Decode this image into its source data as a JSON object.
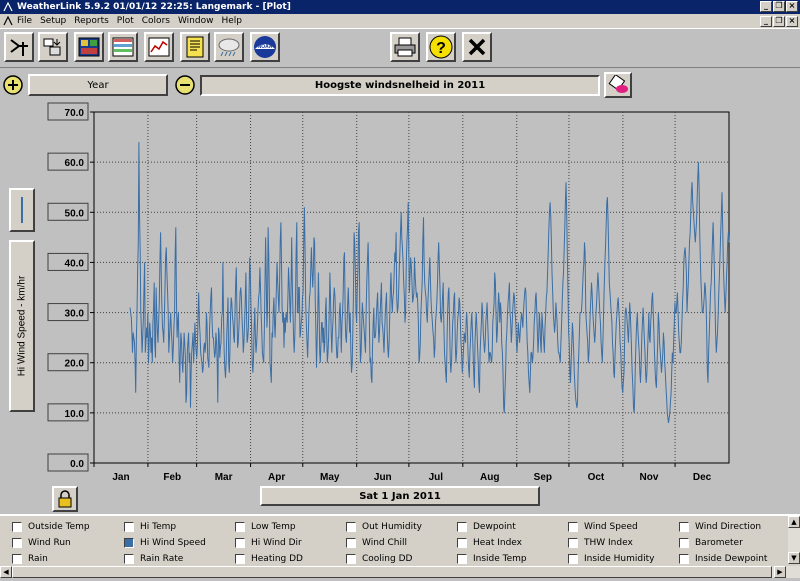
{
  "window": {
    "title": "WeatherLink 5.9.2  01/01/12  22:25: Langemark - [Plot]"
  },
  "menu": [
    "File",
    "Setup",
    "Reports",
    "Plot",
    "Colors",
    "Window",
    "Help"
  ],
  "toolbar": {
    "icons": [
      "station-select-icon",
      "download-icon",
      "bulletin-icon",
      "strip-chart-icon",
      "graph-icon",
      "noaa-summary-icon",
      "weather-upload-icon",
      "noaa-icon",
      "print-icon",
      "help-icon",
      "close-icon"
    ]
  },
  "controls": {
    "span_label": "Year",
    "plot_title": "Hoogste windsnelheid  in 2011",
    "date_label": "Sat 1 Jan 2011"
  },
  "legend": {
    "rows": [
      [
        {
          "label": "Outside Temp",
          "checked": false
        },
        {
          "label": "Hi Temp",
          "checked": false
        },
        {
          "label": "Low Temp",
          "checked": false
        },
        {
          "label": "Out Humidity",
          "checked": false
        },
        {
          "label": "Dewpoint",
          "checked": false
        },
        {
          "label": "Wind Speed",
          "checked": false
        },
        {
          "label": "Wind Direction",
          "checked": false
        }
      ],
      [
        {
          "label": "Wind Run",
          "checked": false
        },
        {
          "label": "Hi Wind Speed",
          "checked": true
        },
        {
          "label": "Hi Wind Dir",
          "checked": false
        },
        {
          "label": "Wind Chill",
          "checked": false
        },
        {
          "label": "Heat Index",
          "checked": false
        },
        {
          "label": "THW Index",
          "checked": false
        },
        {
          "label": "Barometer",
          "checked": false
        }
      ],
      [
        {
          "label": "Rain",
          "checked": false
        },
        {
          "label": "Rain Rate",
          "checked": false
        },
        {
          "label": "Heating DD",
          "checked": false
        },
        {
          "label": "Cooling DD",
          "checked": false
        },
        {
          "label": "Inside Temp",
          "checked": false
        },
        {
          "label": "Inside Humidity",
          "checked": false
        },
        {
          "label": "Inside Dewpoint",
          "checked": false
        }
      ]
    ]
  },
  "chart_data": {
    "type": "line",
    "title": "Hoogste windsnelheid  in 2011",
    "ylabel": "Hi Wind Speed - km/hr",
    "ylim": [
      0,
      70
    ],
    "yticks": [
      "70.0",
      "60.0",
      "50.0",
      "40.0",
      "30.0",
      "20.0",
      "10.0",
      "0.0"
    ],
    "categories": [
      "Jan",
      "Feb",
      "Mar",
      "Apr",
      "May",
      "Jun",
      "Jul",
      "Aug",
      "Sep",
      "Oct",
      "Nov",
      "Dec"
    ],
    "grid": true,
    "series_color": "#3a6ea5",
    "series": [
      {
        "values": [
          31,
          30,
          29,
          26,
          22,
          26,
          25,
          24,
          20,
          14,
          25,
          30,
          38,
          44,
          64,
          50,
          42,
          30,
          26,
          22,
          25,
          29,
          35,
          40,
          22,
          24,
          27,
          25,
          30,
          20,
          24,
          28,
          26,
          22,
          25,
          20,
          28,
          31,
          36,
          24,
          21,
          35,
          30,
          26,
          24,
          28,
          32,
          40,
          46,
          38,
          32,
          27,
          26,
          24,
          29,
          35,
          41,
          43,
          38,
          34,
          30,
          22,
          25,
          28,
          30,
          26,
          24,
          20,
          23,
          27,
          30,
          42,
          47,
          32,
          25,
          28,
          30,
          22,
          16,
          22,
          26,
          24,
          20,
          18,
          22,
          26,
          24,
          21,
          12,
          14,
          22,
          24,
          26,
          20,
          22,
          11,
          18,
          22,
          24,
          26,
          20,
          24,
          28,
          24,
          22,
          21,
          24,
          30,
          34,
          28,
          26,
          22,
          21,
          20,
          18,
          19,
          23,
          24,
          22,
          24,
          30,
          28,
          21,
          20,
          19,
          27,
          30,
          33,
          35,
          28,
          25,
          25,
          23,
          21,
          22,
          26,
          24,
          20,
          12,
          27,
          26,
          21,
          23,
          24,
          29,
          30,
          40,
          28,
          22,
          19,
          17,
          20,
          26,
          29,
          33,
          20,
          18,
          22,
          30,
          33,
          32,
          29,
          28,
          25,
          24,
          30,
          36,
          39,
          31,
          23,
          24,
          27,
          30,
          34,
          35,
          33,
          29,
          26,
          22,
          24,
          28,
          32,
          38,
          30,
          24,
          25,
          27,
          33,
          41,
          38,
          32,
          27,
          20,
          18,
          21,
          27,
          31,
          25,
          22,
          24,
          27,
          30,
          33,
          34,
          39,
          35,
          30,
          26,
          22,
          21,
          20,
          26,
          36,
          45,
          38,
          27,
          30,
          47,
          41,
          33,
          20,
          18,
          16,
          26,
          25,
          30,
          33,
          28,
          25,
          30,
          35,
          40,
          36,
          33,
          30,
          36,
          44,
          48,
          40,
          31,
          28,
          30,
          23,
          29,
          26,
          30,
          29,
          28,
          33,
          39,
          36,
          32,
          28,
          34,
          45,
          36,
          30,
          25,
          22,
          26,
          32,
          42,
          48,
          30,
          30,
          35,
          35,
          25,
          26,
          28,
          29,
          33,
          34,
          45,
          51,
          42,
          32,
          28,
          24,
          21,
          25,
          30,
          33,
          34,
          39,
          43,
          38,
          35,
          38,
          45,
          44,
          33,
          26,
          19,
          24,
          30,
          38,
          31,
          22,
          20,
          24,
          28,
          28,
          24,
          27,
          22,
          24,
          30,
          33,
          26,
          20,
          22,
          25,
          30,
          38,
          33,
          26,
          22,
          26,
          29,
          33,
          35,
          33,
          28,
          24,
          21,
          21,
          25,
          25,
          30,
          32,
          28,
          22,
          28,
          30,
          34,
          41,
          42,
          29,
          25,
          24,
          28,
          32,
          35,
          30,
          26,
          30,
          22,
          18,
          20,
          26,
          33,
          46,
          44,
          39,
          30,
          28,
          35,
          38,
          46,
          48,
          29,
          20,
          22,
          27,
          32,
          30,
          28,
          26,
          24,
          22,
          31,
          36,
          40,
          44,
          38,
          29,
          20,
          21,
          17,
          16,
          23,
          28,
          31,
          25,
          25,
          26,
          29,
          32,
          34,
          28,
          24,
          26,
          30,
          33,
          36,
          28,
          27,
          25,
          22,
          26,
          30,
          32,
          34,
          26,
          23,
          21,
          24,
          29,
          35,
          38,
          33,
          30,
          33,
          34,
          38,
          42,
          40,
          46,
          33,
          30,
          31,
          34,
          39,
          42,
          46,
          50,
          45,
          43,
          40,
          36,
          33,
          28,
          30,
          40,
          44,
          47,
          52,
          42,
          34,
          38,
          41,
          39,
          36,
          32,
          33,
          34,
          41,
          37,
          35,
          33,
          34,
          32,
          28,
          20,
          21,
          24,
          30,
          33,
          36,
          44,
          49,
          40,
          36,
          34,
          33,
          30,
          28,
          32,
          35,
          38,
          41,
          36,
          32,
          30,
          28,
          26,
          25,
          21,
          23,
          28,
          30,
          32,
          36,
          41,
          44,
          39,
          35,
          29,
          28,
          30,
          33,
          36,
          28,
          22,
          20,
          18,
          16,
          24,
          30,
          34,
          35,
          28,
          21,
          18,
          20,
          24,
          28,
          30,
          33,
          34,
          24,
          20,
          22,
          26,
          29,
          30,
          33,
          32,
          28,
          24,
          22,
          18,
          20,
          23,
          26,
          25,
          24,
          28,
          30,
          27,
          22,
          19,
          17,
          22,
          25,
          28,
          30,
          26,
          22,
          18,
          15,
          24,
          28,
          30,
          27,
          23,
          20,
          16,
          14,
          22,
          25,
          28,
          32,
          30,
          26,
          24,
          22,
          24,
          28,
          30,
          32,
          28,
          24,
          20,
          22,
          22,
          21,
          20,
          22,
          28,
          30,
          32,
          38,
          36,
          30,
          24,
          26,
          30,
          34,
          32,
          28,
          32,
          30,
          24,
          22,
          18,
          11,
          10,
          14,
          18,
          24,
          26,
          30,
          32,
          34,
          36,
          30,
          28,
          24,
          26,
          30,
          32,
          34,
          33,
          30,
          28,
          24,
          22,
          25,
          28,
          26,
          24,
          26,
          28,
          30,
          29,
          27,
          30,
          32,
          34,
          35,
          34,
          28,
          24,
          22,
          18,
          16,
          14,
          18,
          22,
          22,
          20,
          21,
          24,
          28,
          30,
          33,
          34,
          30,
          26,
          22,
          25,
          30,
          28,
          24,
          22,
          30,
          28,
          26,
          24,
          22,
          27,
          30,
          33,
          34,
          38,
          42,
          47,
          50,
          52,
          49,
          44,
          38,
          34,
          30,
          28,
          26,
          28,
          32,
          30,
          28,
          24,
          22,
          22,
          21,
          20,
          24,
          28,
          32,
          36,
          38,
          42,
          47,
          52,
          56,
          50,
          42,
          34,
          26,
          24,
          18,
          16,
          20,
          24,
          28,
          26,
          22,
          18,
          15,
          13,
          12,
          11,
          12,
          18,
          22,
          26,
          30,
          30,
          30,
          32,
          35,
          38,
          40,
          44,
          42,
          30,
          28,
          26,
          24,
          20,
          22,
          26,
          30,
          33,
          36,
          34,
          30,
          28,
          26,
          24,
          26,
          30,
          32,
          35,
          38,
          36,
          33,
          30,
          28,
          24,
          22,
          20,
          25,
          30,
          35,
          40,
          43,
          47,
          52,
          53,
          48,
          42,
          36,
          34,
          32,
          30,
          28,
          24,
          22,
          18,
          17,
          22,
          25,
          28,
          30,
          32,
          33,
          30,
          28,
          24,
          22,
          18,
          15,
          14,
          16,
          18,
          24,
          30,
          31,
          30,
          28,
          26,
          24,
          28,
          32,
          30,
          26,
          22,
          18,
          15,
          11,
          10,
          14,
          20,
          25,
          28,
          30,
          26,
          24,
          22,
          18,
          16,
          20,
          25,
          28,
          31,
          28,
          25,
          22,
          18,
          16,
          18,
          22,
          26,
          30,
          25,
          24,
          28,
          30,
          33,
          34,
          30,
          26,
          22,
          18,
          16,
          15,
          20,
          24,
          30,
          28,
          24,
          22,
          20,
          18,
          20,
          22,
          26,
          24,
          20,
          18,
          15,
          13,
          10,
          9,
          8,
          9,
          10,
          12,
          14,
          18,
          22,
          20,
          24,
          28,
          32,
          30,
          30,
          32,
          34,
          30,
          26,
          24,
          22,
          22,
          24,
          28,
          32,
          35,
          40,
          42,
          43,
          41,
          38,
          30,
          33,
          36,
          40,
          44,
          46,
          50,
          54,
          56,
          52,
          50,
          48,
          46,
          44,
          46,
          48,
          53,
          57,
          60,
          55,
          46,
          40,
          36,
          33,
          30,
          30,
          31,
          33,
          36,
          35,
          32,
          26,
          18,
          16,
          22,
          26,
          30,
          34,
          36,
          40,
          44,
          48,
          44,
          38,
          32,
          26,
          22,
          24,
          26,
          30,
          34,
          38,
          42,
          46,
          50,
          54,
          48,
          40,
          36,
          33,
          30,
          33,
          37,
          40,
          44,
          46,
          44
        ]
      }
    ]
  }
}
